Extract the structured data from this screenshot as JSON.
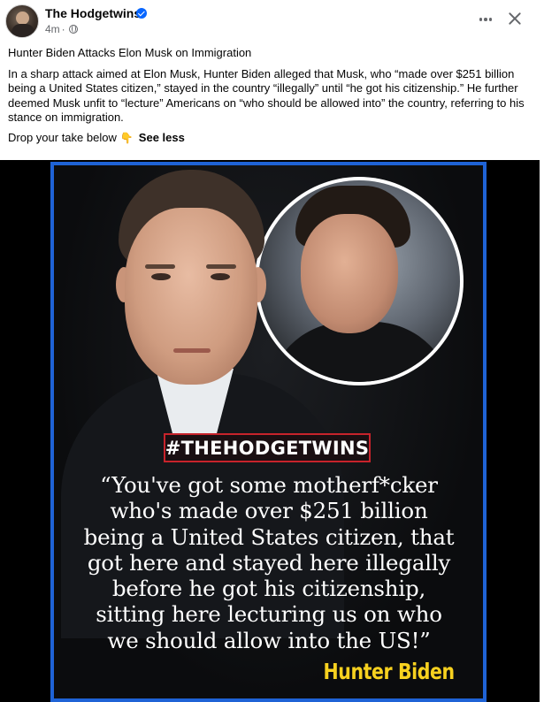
{
  "post": {
    "page_name": "The Hodgetwins",
    "timestamp": "4m",
    "meta_separator": "·",
    "headline": "Hunter Biden Attacks Elon Musk on Immigration",
    "body": "In a sharp attack aimed at Elon Musk, Hunter Biden alleged that Musk, who “made over $251 billion being a United States citizen,” stayed in the country “illegally” until “he got his citizenship.” He further deemed Musk unfit to “lecture” Americans on “who should be allowed into” the country, referring to his stance on immigration.",
    "drop_text": "Drop your take below",
    "hand_emoji": "👇",
    "see_less": "See less"
  },
  "image": {
    "hashtag": "#THEHODGETWINS",
    "quote_lines": [
      "“You've got some motherf*cker",
      "who's made over $251 billion",
      "being a United States citizen, that",
      "got here and stayed here illegally",
      "before he got his citizenship,",
      "sitting here lecturing us on who",
      "we should allow into the US!”"
    ],
    "attribution": "Hunter Biden"
  },
  "icons": {
    "verified": "verified-badge-icon",
    "privacy": "globe-icon",
    "more": "more-options-icon",
    "close": "close-icon"
  },
  "colors": {
    "verified_blue": "#0866ff",
    "frame_blue": "#1f63d6",
    "hashtag_red": "#c7232b",
    "attribution_yellow": "#f7d11f",
    "secondary_text": "#65676b"
  }
}
